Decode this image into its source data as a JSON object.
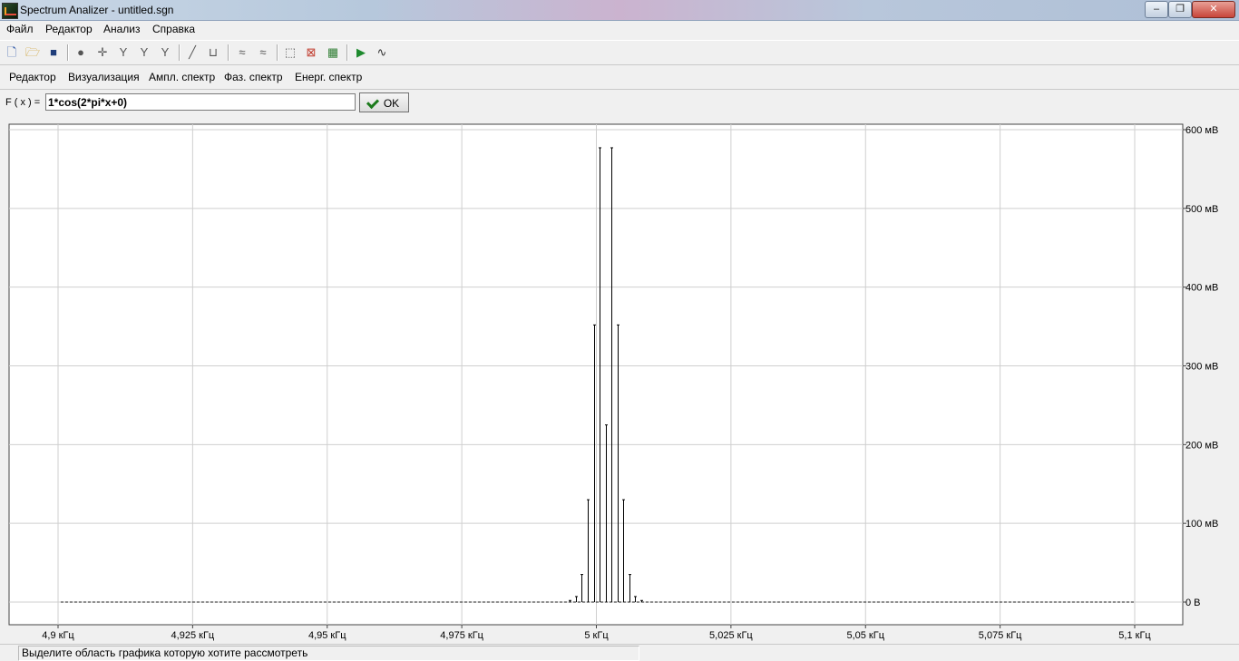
{
  "window": {
    "title": "Spectrum Analizer - untitled.sgn",
    "controls": {
      "minimize": "‒",
      "maximize": "❐",
      "close": "✕"
    }
  },
  "menu": {
    "items": [
      {
        "label": "Файл"
      },
      {
        "label": "Редактор"
      },
      {
        "label": "Анализ"
      },
      {
        "label": "Справка"
      }
    ]
  },
  "toolbar": {
    "icons": [
      "new-file-icon",
      "open-folder-icon",
      "save-disk-icon",
      "zoom-icon",
      "crosshair-icon",
      "filter-icon",
      "filter-alt-icon",
      "filter-wide-icon",
      "line-tool-icon",
      "bracket-tool-icon",
      "signal-transform-icon",
      "signal-transform-alt-icon",
      "zoom-area-icon",
      "zoom-reset-icon",
      "chart-export-icon",
      "play-icon",
      "waveform-icon"
    ]
  },
  "tabs": [
    {
      "label": "Редактор"
    },
    {
      "label": "Визуализация"
    },
    {
      "label": "Ампл. спектр",
      "active": true
    },
    {
      "label": "Фаз. спектр"
    },
    {
      "label": "Енерг. спектр"
    }
  ],
  "formula": {
    "label": "F ( x ) =",
    "value": "1*cos(2*pi*x+0)",
    "ok_label": "OK"
  },
  "status": {
    "text": "Выделите область графика которую хотите рассмотреть"
  },
  "chart_data": {
    "type": "bar",
    "x_ticks": [
      "4,9 кГц",
      "4,925 кГц",
      "4,95 кГц",
      "4,975 кГц",
      "5 кГц",
      "5,025 кГц",
      "5,05 кГц",
      "5,075 кГц",
      "5,1 кГц"
    ],
    "y_ticks": [
      "600 мВ",
      "500 мВ",
      "400 мВ",
      "300 мВ",
      "200 мВ",
      "100 мВ",
      "0 В"
    ],
    "x_range_khz": [
      4.9,
      5.1
    ],
    "ylim_mv": [
      0,
      600
    ],
    "grid": true,
    "baseline_style": "dashed",
    "spikes": [
      {
        "x": 4.995,
        "y": 2
      },
      {
        "x": 4.9962,
        "y": 7
      },
      {
        "x": 4.9973,
        "y": 35
      },
      {
        "x": 4.9984,
        "y": 130
      },
      {
        "x": 4.9995,
        "y": 352
      },
      {
        "x": 5.0006,
        "y": 577
      },
      {
        "x": 5.0017,
        "y": 225
      },
      {
        "x": 5.0028,
        "y": 577
      },
      {
        "x": 5.0039,
        "y": 352
      },
      {
        "x": 5.005,
        "y": 130
      },
      {
        "x": 5.0061,
        "y": 35
      },
      {
        "x": 5.0072,
        "y": 7
      },
      {
        "x": 5.0083,
        "y": 2
      }
    ],
    "baseline_x_range_khz": [
      4.9005,
      5.1
    ]
  }
}
